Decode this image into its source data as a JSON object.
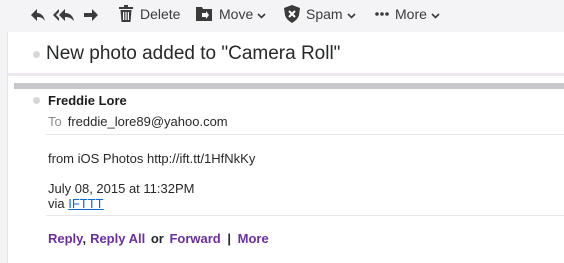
{
  "toolbar": {
    "delete_label": "Delete",
    "move_label": "Move",
    "spam_label": "Spam",
    "more_label": "More",
    "icons": [
      "reply-icon",
      "reply-all-icon",
      "forward-icon",
      "trash-icon",
      "move-folder-icon",
      "spam-shield-icon",
      "ellipsis-icon",
      "chevron-down-icon"
    ]
  },
  "message": {
    "subject": "New photo added to \"Camera Roll\"",
    "sender": "Freddie Lore",
    "to_label": "To",
    "to_email": "freddie_lore89@yahoo.com",
    "body_line": "from iOS Photos http://ift.tt/1HfNkKy",
    "date": "July 08, 2015 at 11:32PM",
    "via_label": "via",
    "via_link": "IFTTT"
  },
  "actions": {
    "reply": "Reply",
    "comma": ",",
    "reply_all": "Reply All",
    "or": "or",
    "forward": "Forward",
    "pipe": "|",
    "more": "More"
  },
  "colors": {
    "action_link": "#6b2fa2",
    "hyperlink": "#0f69d1",
    "background": "#f4f4f6"
  }
}
